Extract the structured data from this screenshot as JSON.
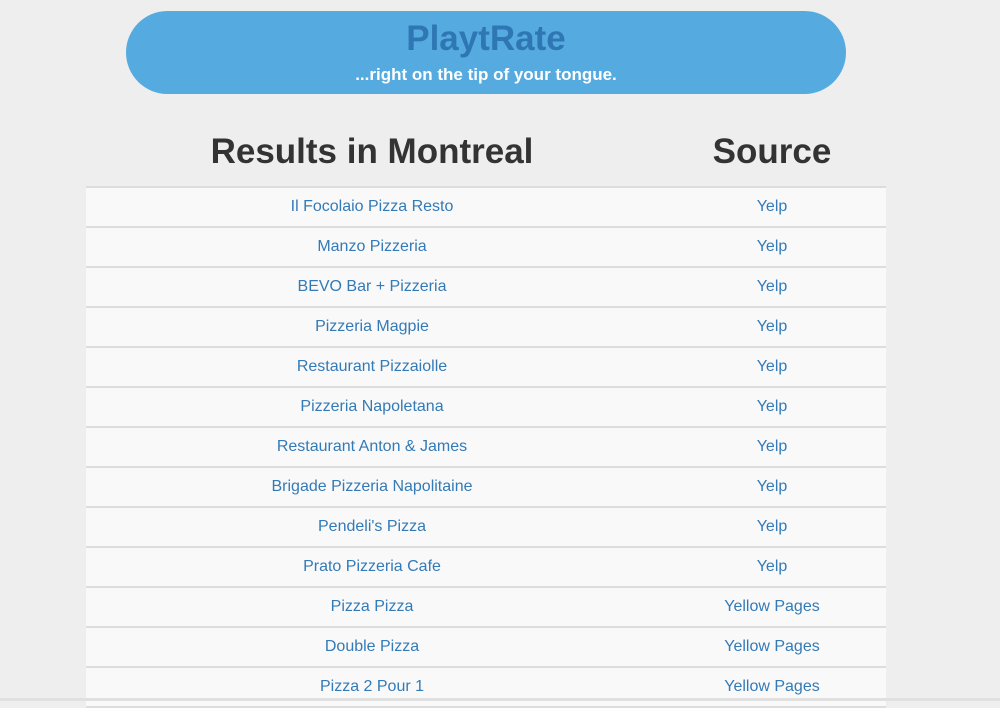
{
  "header": {
    "brand": "PlaytRate",
    "tagline": "...right on the tip of your tongue."
  },
  "table": {
    "columns": [
      "Results in Montreal",
      "Source"
    ],
    "rows": [
      {
        "name": "Il Focolaio Pizza Resto",
        "source": "Yelp"
      },
      {
        "name": "Manzo Pizzeria",
        "source": "Yelp"
      },
      {
        "name": "BEVO Bar + Pizzeria",
        "source": "Yelp"
      },
      {
        "name": "Pizzeria Magpie",
        "source": "Yelp"
      },
      {
        "name": "Restaurant Pizzaiolle",
        "source": "Yelp"
      },
      {
        "name": "Pizzeria Napoletana",
        "source": "Yelp"
      },
      {
        "name": "Restaurant Anton & James",
        "source": "Yelp"
      },
      {
        "name": "Brigade Pizzeria Napolitaine",
        "source": "Yelp"
      },
      {
        "name": "Pendeli's Pizza",
        "source": "Yelp"
      },
      {
        "name": "Prato Pizzeria Cafe",
        "source": "Yelp"
      },
      {
        "name": "Pizza Pizza",
        "source": "Yellow Pages"
      },
      {
        "name": "Double Pizza",
        "source": "Yellow Pages"
      },
      {
        "name": "Pizza 2 Pour 1",
        "source": "Yellow Pages"
      }
    ]
  },
  "colors": {
    "header_bg": "#55abe0",
    "brand_text": "#2f77b4",
    "link": "#337ab7",
    "page_bg": "#eeeeee"
  }
}
